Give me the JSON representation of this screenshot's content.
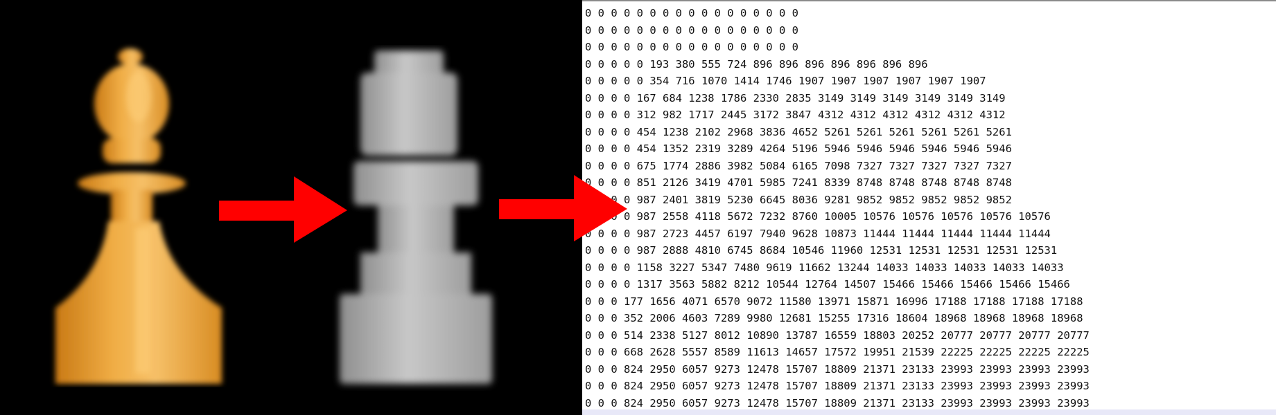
{
  "arrow_color": "#ff0000",
  "images": {
    "color_piece": {
      "icon": "chess-pawn-icon",
      "color": "#e8a33a"
    },
    "gray_piece": {
      "icon": "chess-pawn-icon",
      "color": "#b4b4b4"
    }
  },
  "matrix_rows": [
    "0 0 0 0 0 0 0 0 0 0 0 0 0 0 0 0 0",
    "0 0 0 0 0 0 0 0 0 0 0 0 0 0 0 0 0",
    "0 0 0 0 0 0 0 0 0 0 0 0 0 0 0 0 0",
    "0 0 0 0 0 193 380 555 724 896 896 896 896 896 896 896",
    "0 0 0 0 0 354 716 1070 1414 1746 1907 1907 1907 1907 1907 1907",
    "0 0 0 0 167 684 1238 1786 2330 2835 3149 3149 3149 3149 3149 3149",
    "0 0 0 0 312 982 1717 2445 3172 3847 4312 4312 4312 4312 4312 4312",
    "0 0 0 0 454 1238 2102 2968 3836 4652 5261 5261 5261 5261 5261 5261",
    "0 0 0 0 454 1352 2319 3289 4264 5196 5946 5946 5946 5946 5946 5946",
    "0 0 0 0 675 1774 2886 3982 5084 6165 7098 7327 7327 7327 7327 7327",
    "0 0 0 0 851 2126 3419 4701 5985 7241 8339 8748 8748 8748 8748 8748",
    "0 0 0 0 987 2401 3819 5230 6645 8036 9281 9852 9852 9852 9852 9852",
    "0 0 0 0 987 2558 4118 5672 7232 8760 10005 10576 10576 10576 10576 10576",
    "0 0 0 0 987 2723 4457 6197 7940 9628 10873 11444 11444 11444 11444 11444",
    "0 0 0 0 987 2888 4810 6745 8684 10546 11960 12531 12531 12531 12531 12531",
    "0 0 0 0 1158 3227 5347 7480 9619 11662 13244 14033 14033 14033 14033 14033",
    "0 0 0 0 1317 3563 5882 8212 10544 12764 14507 15466 15466 15466 15466 15466",
    "0 0 0 177 1656 4071 6570 9072 11580 13971 15871 16996 17188 17188 17188 17188",
    "0 0 0 352 2006 4603 7289 9980 12681 15255 17316 18604 18968 18968 18968 18968",
    "0 0 0 514 2338 5127 8012 10890 13787 16559 18803 20252 20777 20777 20777 20777",
    "0 0 0 668 2628 5557 8589 11613 14657 17572 19951 21539 22225 22225 22225 22225",
    "0 0 0 824 2950 6057 9273 12478 15707 18809 21371 23133 23993 23993 23993 23993",
    "0 0 0 824 2950 6057 9273 12478 15707 18809 21371 23133 23993 23993 23993 23993",
    "0 0 0 824 2950 6057 9273 12478 15707 18809 21371 23133 23993 23993 23993 23993"
  ]
}
